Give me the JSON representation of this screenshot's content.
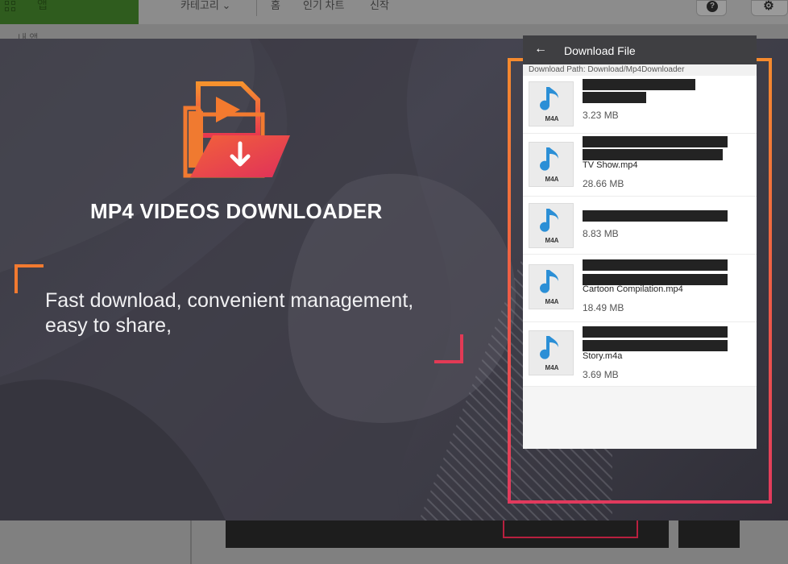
{
  "background": {
    "app_tab_label": "앱",
    "nav_items": [
      "카테고리",
      "홈",
      "인기 차트",
      "신작"
    ],
    "side_label": "내 앱",
    "help_icon": "help-icon",
    "settings_icon": "gear-icon"
  },
  "banner": {
    "app_title": "MP4 VIDEOS DOWNLOADER",
    "tagline_line1": "Fast download, convenient management,",
    "tagline_line2": "easy to share,",
    "colors": {
      "orange": "#f27a30",
      "pink": "#e23a55"
    }
  },
  "phone": {
    "header_title": "Download File",
    "back_icon": "arrow-left-icon",
    "download_path": "Download Path: Download/Mp4Downloader",
    "files": [
      {
        "icon_label": "M4A",
        "name": "",
        "size": "3.23 MB"
      },
      {
        "icon_label": "M4A",
        "name": "TV Show.mp4",
        "size": "28.66 MB"
      },
      {
        "icon_label": "M4A",
        "name": "",
        "size": "8.83 MB"
      },
      {
        "icon_label": "M4A",
        "name": "Cartoon Compilation.mp4",
        "size": "18.49 MB"
      },
      {
        "icon_label": "M4A",
        "name": "Story.m4a",
        "size": "3.69 MB"
      }
    ]
  }
}
